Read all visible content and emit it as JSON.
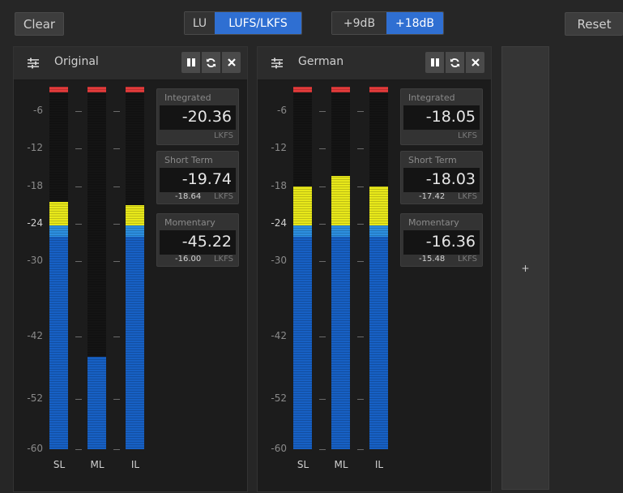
{
  "toolbar": {
    "clear_label": "Clear",
    "reset_label": "Reset",
    "unit_toggle": {
      "options": [
        "LU",
        "LUFS/LKFS"
      ],
      "selected": "LUFS/LKFS"
    },
    "range_toggle": {
      "options": [
        "+9dB",
        "+18dB"
      ],
      "selected": "+18dB"
    }
  },
  "scale_labels": [
    "-6",
    "-12",
    "-18",
    "-24",
    "-30",
    "-42",
    "-52",
    "-60"
  ],
  "panels": [
    {
      "name": "Original",
      "channels": [
        {
          "label": "SL",
          "level_db": -20.5,
          "peak": true
        },
        {
          "label": "ML",
          "level_db": -45.2,
          "peak": true
        },
        {
          "label": "IL",
          "level_db": -21.0,
          "peak": true
        }
      ],
      "integrated": {
        "title": "Integrated",
        "value": "-20.36",
        "unit": "LKFS"
      },
      "short_term": {
        "title": "Short Term",
        "value": "-19.74",
        "sub_value": "-18.64",
        "unit": "LKFS"
      },
      "momentary": {
        "title": "Momentary",
        "value": "-45.22",
        "sub_value": "-16.00",
        "unit": "LKFS"
      }
    },
    {
      "name": "German",
      "channels": [
        {
          "label": "SL",
          "level_db": -18.0,
          "peak": true
        },
        {
          "label": "ML",
          "level_db": -16.4,
          "peak": true
        },
        {
          "label": "IL",
          "level_db": -18.0,
          "peak": true
        }
      ],
      "integrated": {
        "title": "Integrated",
        "value": "-18.05",
        "unit": "LKFS"
      },
      "short_term": {
        "title": "Short Term",
        "value": "-18.03",
        "sub_value": "-17.42",
        "unit": "LKFS"
      },
      "momentary": {
        "title": "Momentary",
        "value": "-16.36",
        "sub_value": "-15.48",
        "unit": "LKFS"
      }
    }
  ],
  "add_panel_label": "+",
  "header_icons": [
    "sliders-icon",
    "pause-icon",
    "refresh-icon",
    "close-icon"
  ]
}
